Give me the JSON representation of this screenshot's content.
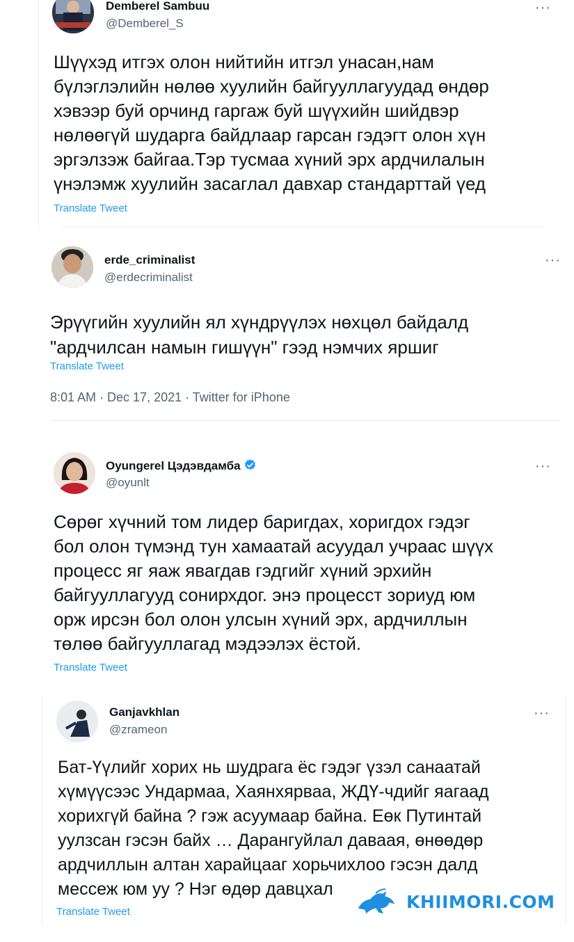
{
  "tweets": [
    {
      "name": "Demberel Sambuu",
      "handle": "@Demberel_S",
      "text": "Шүүхэд итгэх олон нийтийн итгэл унасан,нам\nбүлэглэлийн нөлөө хуулийн байгууллагуудад өндөр\nхэвээр буй орчинд гаргаж буй шүүхийн шийдвэр\nнөлөөгүй шударга байдлаар гарсан гэдэгт олон хүн\nэргэлзэж байгаа.Тэр тусмаа хүний эрх ардчилалын\nүнэлэмж хуулийн засаглал давхар стандарттай үед",
      "translate": "Translate Tweet"
    },
    {
      "name": "erde_criminalist",
      "handle": "@erdecriminalist",
      "text": "Эрүүгийн хуулийн ял хүндрүүлэх нөхцөл байдалд\n\"ардчилсан намын гишүүн\" гээд нэмчих яршиг",
      "translate": "Translate Tweet",
      "meta": "8:01 AM · Dec 17, 2021 · Twitter for iPhone"
    },
    {
      "name": "Oyungerel Цэдэвдамба",
      "handle": "@oyunlt",
      "text": "Сөрөг хүчний том лидер баригдах, хоригдох гэдэг\nбол олон түмэнд тун хамаатай асуудал учраас шүүх\nпроцесс яг яаж явагдав гэдгийг хүний эрхийн\nбайгууллагууд сонирхдог. энэ процесст зориуд юм\nорж ирсэн бол олон улсын хүний эрх, ардчиллын\nтөлөө байгууллагад мэдээлэх ёстой.",
      "translate": "Translate Tweet"
    },
    {
      "name": "Ganjavkhlan",
      "handle": "@zrameon",
      "text": "Бат-Үүлийг хорих нь шудрага ёс гэдэг үзэл санаатай\nхүмүүсээс Ундармаа, Хаянхярваа, ЖДҮ-чдийг яагаад\nхорихгүй байна ? гэж асуумаар байна. Еөк Путинтай\nуулзсан гэсэн байх … Дарангуйлал даваая, өнөөдөр\nардчиллын алтан харайцааг хорьчихлоо гэсэн далд\nмессеж юм уу ? Нэг өдөр давцхал",
      "translate": "Translate Tweet"
    }
  ],
  "more_glyph": "···",
  "watermark": {
    "text": "KHIIMORI.COM"
  },
  "colors": {
    "text": "#0f1419",
    "secondary": "#536471",
    "link": "#1d9bf0",
    "verified": "#1d9bf0",
    "watermark": "#1f8fe0"
  },
  "icons": [
    "more-icon",
    "verified-badge-icon",
    "horse-logo-icon"
  ]
}
